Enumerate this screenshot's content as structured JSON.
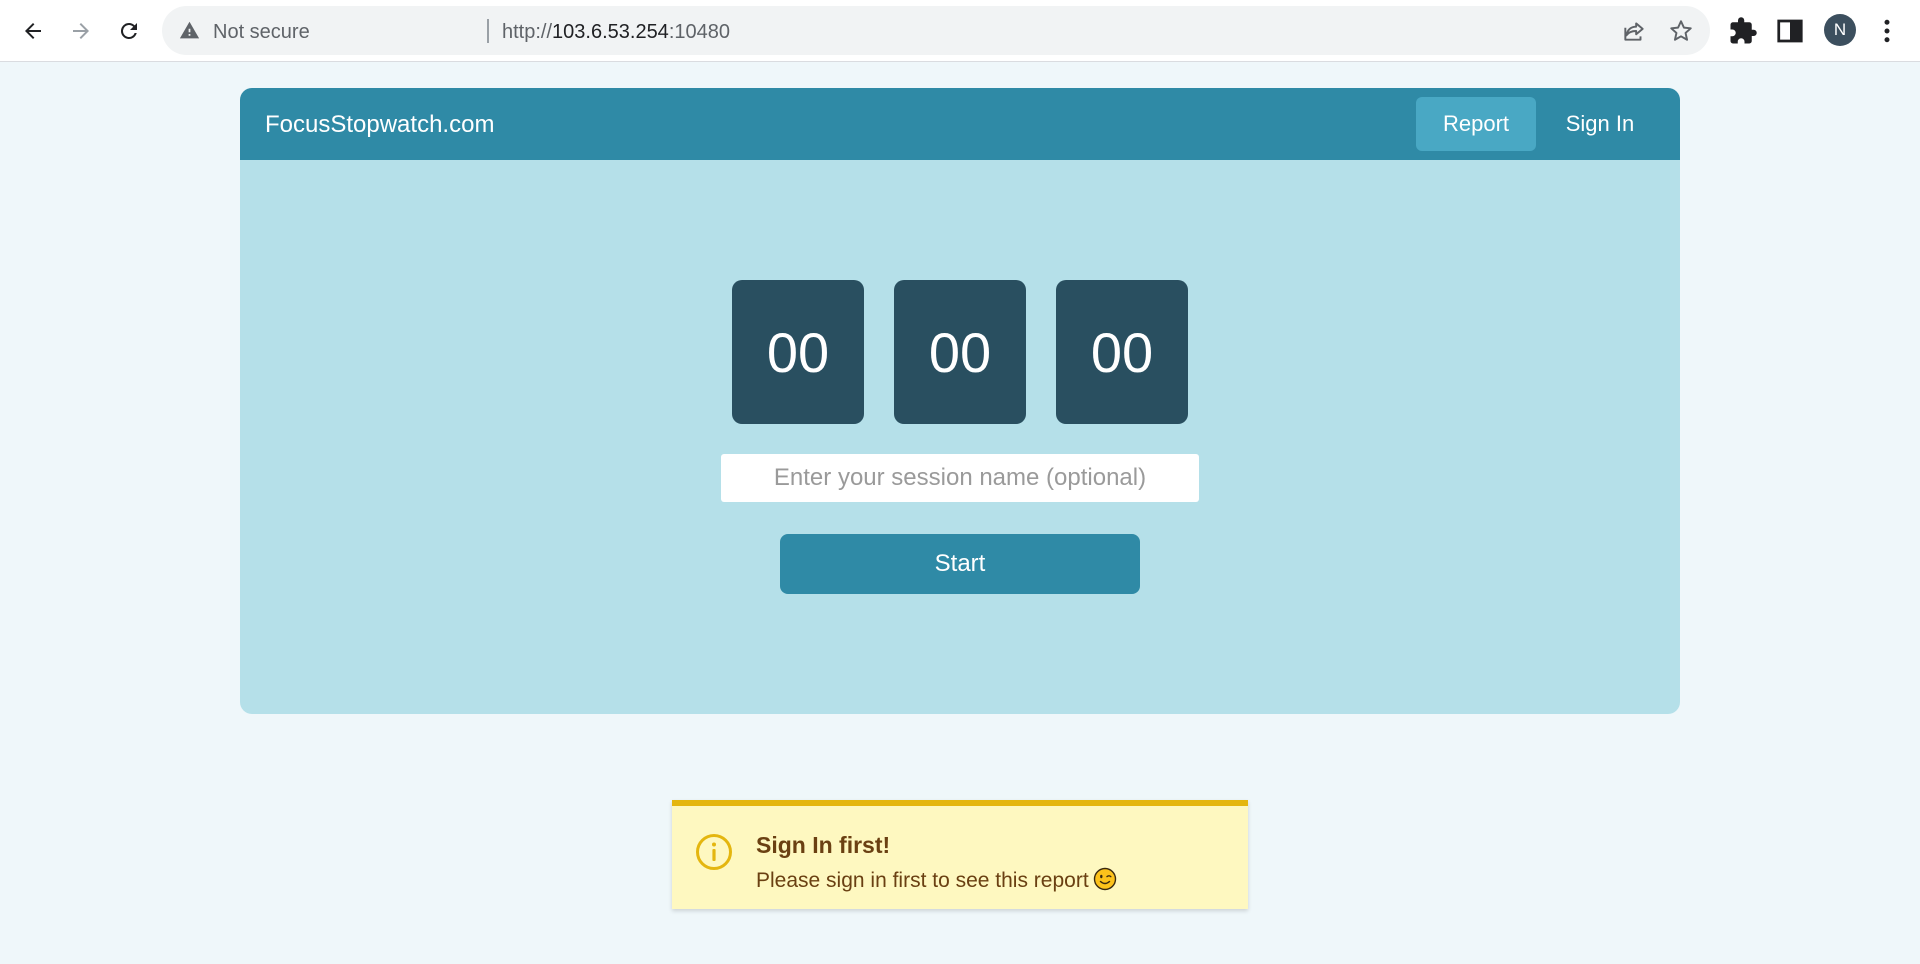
{
  "browser": {
    "security_label": "Not secure",
    "url_scheme": "http://",
    "url_host": "103.6.53.254",
    "url_port": ":10480",
    "profile_initial": "N"
  },
  "header": {
    "brand": "FocusStopwatch.com",
    "nav": {
      "report_label": "Report",
      "signin_label": "Sign In"
    }
  },
  "timer": {
    "hours": "00",
    "minutes": "00",
    "seconds": "00"
  },
  "session": {
    "placeholder": "Enter your session name (optional)",
    "value": ""
  },
  "start_label": "Start",
  "toast": {
    "title": "Sign In first!",
    "message": "Please sign in first to see this report",
    "emoji": "winking-face-icon"
  },
  "colors": {
    "header_bg": "#2f8aa6",
    "card_bg": "#b5e0e9",
    "digit_bg": "#294f60",
    "page_bg": "#eff7fa",
    "toast_bg": "#fef8c0",
    "toast_accent": "#e4b60f"
  }
}
